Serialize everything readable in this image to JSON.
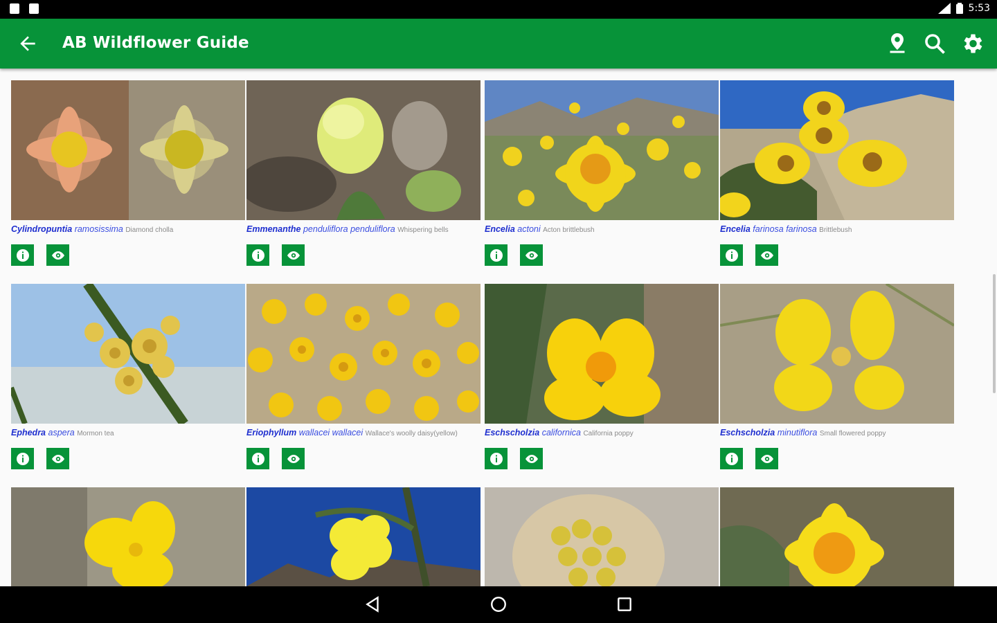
{
  "status_bar": {
    "time": "5:53",
    "icons": [
      "note-icon",
      "note-icon",
      "signal-icon",
      "battery-icon"
    ]
  },
  "app_bar": {
    "title": "AB Wildflower Guide",
    "actions": [
      "map-pin-icon",
      "search-icon",
      "settings-gear-icon"
    ],
    "background": "#079339"
  },
  "species": [
    {
      "genus": "Cylindropuntia",
      "species": "ramosissima",
      "common": "Diamond cholla"
    },
    {
      "genus": "Emmenanthe",
      "species": "penduliflora penduliflora",
      "common": "Whispering bells"
    },
    {
      "genus": "Encelia",
      "species": "actoni",
      "common": "Acton brittlebush"
    },
    {
      "genus": "Encelia",
      "species": "farinosa farinosa",
      "common": "Brittlebush"
    },
    {
      "genus": "Ephedra",
      "species": "aspera",
      "common": "Mormon tea"
    },
    {
      "genus": "Eriophyllum",
      "species": "wallacei wallacei",
      "common": "Wallace's woolly daisy(yellow)"
    },
    {
      "genus": "Eschscholzia",
      "species": "californica",
      "common": "California poppy"
    },
    {
      "genus": "Eschscholzia",
      "species": "minutiflora",
      "common": "Small flowered poppy"
    }
  ],
  "card_buttons": [
    "info-icon",
    "eye-icon"
  ],
  "nav_bar": [
    "back-triangle-icon",
    "home-circle-icon",
    "recents-square-icon"
  ]
}
